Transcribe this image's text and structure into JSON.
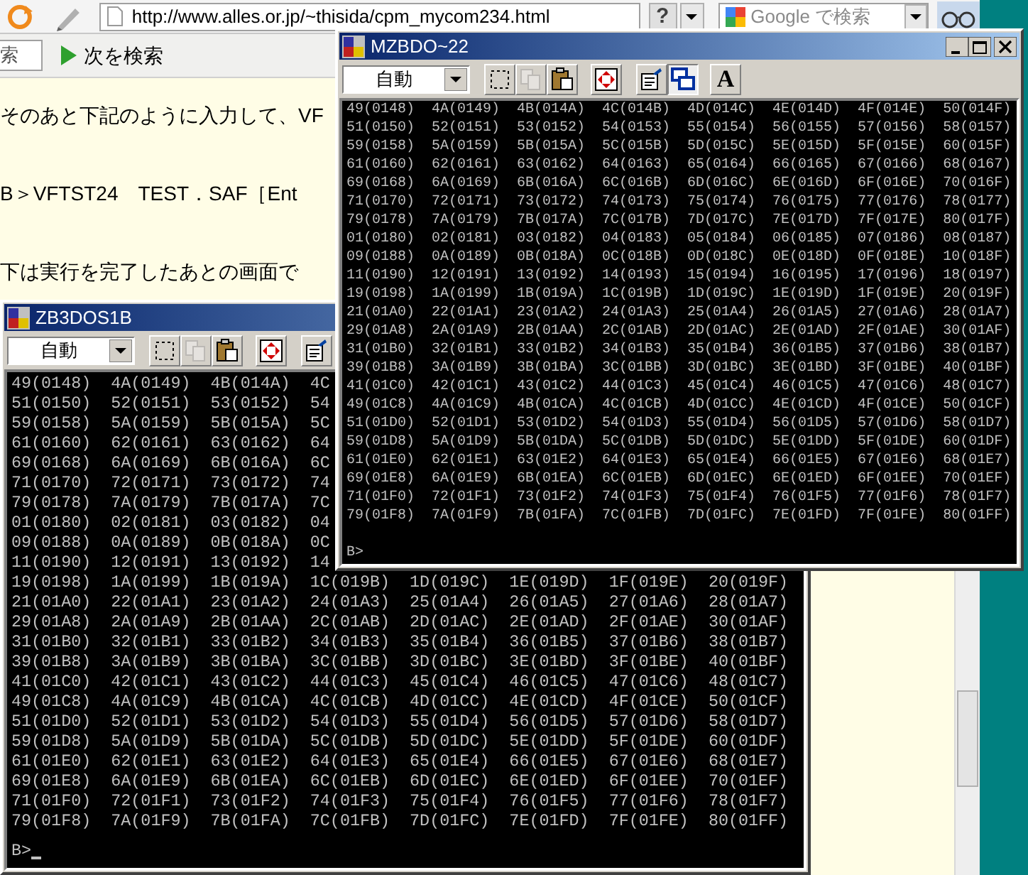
{
  "browser": {
    "address": "http://www.alles.or.jp/~thisida/cpm_mycom234.html",
    "help_button": "?",
    "search_placeholder": "Google で検索",
    "find_bar": {
      "field_value": "索",
      "next_button": "次を検索"
    },
    "page": {
      "paragraphs": [
        "そのあと下記のように入力して、VF",
        "B＞VFTST24　TEST．SAF［Ent",
        "下は実行を完了したあとの画面で"
      ]
    }
  },
  "windows": [
    {
      "title": "ZB3DOS1B",
      "font_size": "自動",
      "toolbar": [
        {
          "kind": "mark",
          "pressed": false,
          "disabled": false
        },
        {
          "kind": "copy",
          "pressed": false,
          "disabled": true
        },
        {
          "kind": "paste",
          "pressed": false,
          "disabled": false
        },
        {
          "kind": "fullscreen",
          "pressed": false,
          "disabled": false
        },
        {
          "kind": "properties",
          "pressed": false,
          "disabled": false
        }
      ],
      "lines": [
        "49(0148)  4A(0149)  4B(014A)  4C",
        "51(0150)  52(0151)  53(0152)  54",
        "59(0158)  5A(0159)  5B(015A)  5C",
        "61(0160)  62(0161)  63(0162)  64",
        "69(0168)  6A(0169)  6B(016A)  6C",
        "71(0170)  72(0171)  73(0172)  74",
        "79(0178)  7A(0179)  7B(017A)  7C",
        "01(0180)  02(0181)  03(0182)  04",
        "09(0188)  0A(0189)  0B(018A)  0C",
        "11(0190)  12(0191)  13(0192)  14",
        "19(0198)  1A(0199)  1B(019A)  1C(019B)  1D(019C)  1E(019D)  1F(019E)  20(019F)",
        "21(01A0)  22(01A1)  23(01A2)  24(01A3)  25(01A4)  26(01A5)  27(01A6)  28(01A7)",
        "29(01A8)  2A(01A9)  2B(01AA)  2C(01AB)  2D(01AC)  2E(01AD)  2F(01AE)  30(01AF)",
        "31(01B0)  32(01B1)  33(01B2)  34(01B3)  35(01B4)  36(01B5)  37(01B6)  38(01B7)",
        "39(01B8)  3A(01B9)  3B(01BA)  3C(01BB)  3D(01BC)  3E(01BD)  3F(01BE)  40(01BF)",
        "41(01C0)  42(01C1)  43(01C2)  44(01C3)  45(01C4)  46(01C5)  47(01C6)  48(01C7)",
        "49(01C8)  4A(01C9)  4B(01CA)  4C(01CB)  4D(01CC)  4E(01CD)  4F(01CE)  50(01CF)",
        "51(01D0)  52(01D1)  53(01D2)  54(01D3)  55(01D4)  56(01D5)  57(01D6)  58(01D7)",
        "59(01D8)  5A(01D9)  5B(01DA)  5C(01DB)  5D(01DC)  5E(01DD)  5F(01DE)  60(01DF)",
        "61(01E0)  62(01E1)  63(01E2)  64(01E3)  65(01E4)  66(01E5)  67(01E6)  68(01E7)",
        "69(01E8)  6A(01E9)  6B(01EA)  6C(01EB)  6D(01EC)  6E(01ED)  6F(01EE)  70(01EF)",
        "71(01F0)  72(01F1)  73(01F2)  74(01F3)  75(01F4)  76(01F5)  77(01F6)  78(01F7)",
        "79(01F8)  7A(01F9)  7B(01FA)  7C(01FB)  7D(01FC)  7E(01FD)  7F(01FE)  80(01FF)"
      ],
      "prompt": "B>",
      "cursor": true
    },
    {
      "title": "MZBDO~22",
      "font_size": "自動",
      "toolbar": [
        {
          "kind": "mark",
          "pressed": false,
          "disabled": false
        },
        {
          "kind": "copy",
          "pressed": false,
          "disabled": true
        },
        {
          "kind": "paste",
          "pressed": false,
          "disabled": false
        },
        {
          "kind": "fullscreen",
          "pressed": false,
          "disabled": false
        },
        {
          "kind": "properties",
          "pressed": false,
          "disabled": false
        },
        {
          "kind": "background",
          "pressed": true,
          "disabled": false
        },
        {
          "kind": "font",
          "label": "A",
          "pressed": false,
          "disabled": false
        }
      ],
      "lines": [
        "49(0148)  4A(0149)  4B(014A)  4C(014B)  4D(014C)  4E(014D)  4F(014E)  50(014F)",
        "51(0150)  52(0151)  53(0152)  54(0153)  55(0154)  56(0155)  57(0156)  58(0157)",
        "59(0158)  5A(0159)  5B(015A)  5C(015B)  5D(015C)  5E(015D)  5F(015E)  60(015F)",
        "61(0160)  62(0161)  63(0162)  64(0163)  65(0164)  66(0165)  67(0166)  68(0167)",
        "69(0168)  6A(0169)  6B(016A)  6C(016B)  6D(016C)  6E(016D)  6F(016E)  70(016F)",
        "71(0170)  72(0171)  73(0172)  74(0173)  75(0174)  76(0175)  77(0176)  78(0177)",
        "79(0178)  7A(0179)  7B(017A)  7C(017B)  7D(017C)  7E(017D)  7F(017E)  80(017F)",
        "01(0180)  02(0181)  03(0182)  04(0183)  05(0184)  06(0185)  07(0186)  08(0187)",
        "09(0188)  0A(0189)  0B(018A)  0C(018B)  0D(018C)  0E(018D)  0F(018E)  10(018F)",
        "11(0190)  12(0191)  13(0192)  14(0193)  15(0194)  16(0195)  17(0196)  18(0197)",
        "19(0198)  1A(0199)  1B(019A)  1C(019B)  1D(019C)  1E(019D)  1F(019E)  20(019F)",
        "21(01A0)  22(01A1)  23(01A2)  24(01A3)  25(01A4)  26(01A5)  27(01A6)  28(01A7)",
        "29(01A8)  2A(01A9)  2B(01AA)  2C(01AB)  2D(01AC)  2E(01AD)  2F(01AE)  30(01AF)",
        "31(01B0)  32(01B1)  33(01B2)  34(01B3)  35(01B4)  36(01B5)  37(01B6)  38(01B7)",
        "39(01B8)  3A(01B9)  3B(01BA)  3C(01BB)  3D(01BC)  3E(01BD)  3F(01BE)  40(01BF)",
        "41(01C0)  42(01C1)  43(01C2)  44(01C3)  45(01C4)  46(01C5)  47(01C6)  48(01C7)",
        "49(01C8)  4A(01C9)  4B(01CA)  4C(01CB)  4D(01CC)  4E(01CD)  4F(01CE)  50(01CF)",
        "51(01D0)  52(01D1)  53(01D2)  54(01D3)  55(01D4)  56(01D5)  57(01D6)  58(01D7)",
        "59(01D8)  5A(01D9)  5B(01DA)  5C(01DB)  5D(01DC)  5E(01DD)  5F(01DE)  60(01DF)",
        "61(01E0)  62(01E1)  63(01E2)  64(01E3)  65(01E4)  66(01E5)  67(01E6)  68(01E7)",
        "69(01E8)  6A(01E9)  6B(01EA)  6C(01EB)  6D(01EC)  6E(01ED)  6F(01EE)  70(01EF)",
        "71(01F0)  72(01F1)  73(01F2)  74(01F3)  75(01F4)  76(01F5)  77(01F6)  78(01F7)",
        "79(01F8)  7A(01F9)  7B(01FA)  7C(01FB)  7D(01FC)  7E(01FD)  7F(01FE)  80(01FF)"
      ],
      "prompt": "B>",
      "cursor": false
    }
  ]
}
